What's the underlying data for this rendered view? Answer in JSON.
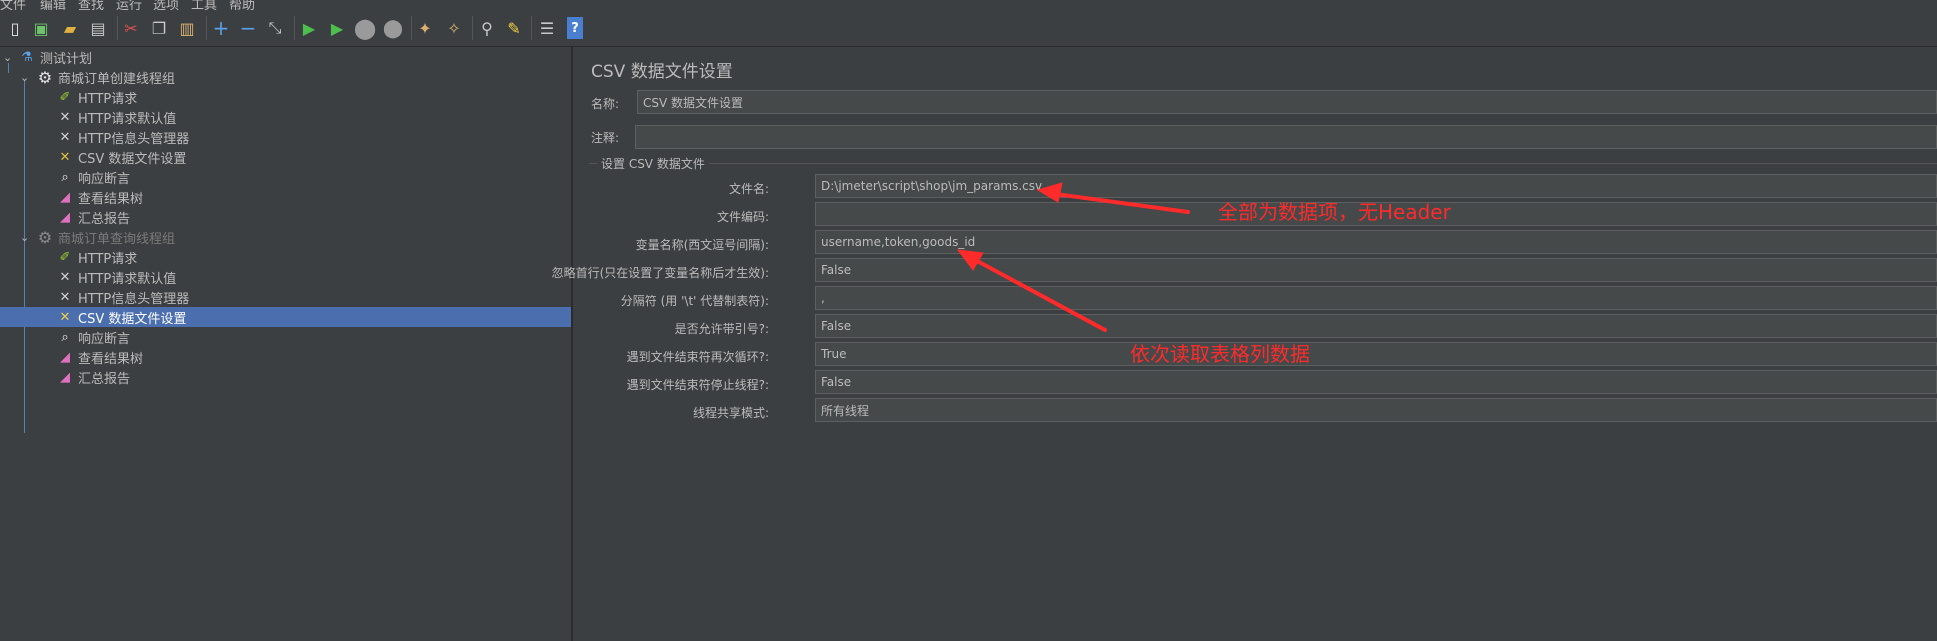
{
  "menu": [
    "文件",
    "编辑",
    "查找",
    "运行",
    "选项",
    "工具",
    "帮助"
  ],
  "toolbar_icons": [
    "new-icon",
    "templates-icon",
    "open-icon",
    "save-icon",
    "cut-icon",
    "copy-icon",
    "paste-icon",
    "expand-icon",
    "collapse-icon",
    "toggle-icon",
    "start-icon",
    "start-no-pause-icon",
    "stop-icon",
    "shutdown-icon",
    "clear-icon",
    "clear-all-icon",
    "search-icon",
    "reset-search-icon",
    "function-helper-icon",
    "help-icon"
  ],
  "tree": {
    "root": "测试计划",
    "group1": "商城订单创建线程组",
    "group1_items": [
      "HTTP请求",
      "HTTP请求默认值",
      "HTTP信息头管理器",
      "CSV 数据文件设置",
      "响应断言",
      "查看结果树",
      "汇总报告"
    ],
    "group2": "商城订单查询线程组",
    "group2_items": [
      "HTTP请求",
      "HTTP请求默认值",
      "HTTP信息头管理器",
      "CSV 数据文件设置",
      "响应断言",
      "查看结果树",
      "汇总报告"
    ]
  },
  "panel": {
    "title": "CSV 数据文件设置",
    "name_label": "名称:",
    "name_value": "CSV 数据文件设置",
    "comment_label": "注释:",
    "comment_value": "",
    "section_title": "设置 CSV 数据文件",
    "fields": [
      {
        "label": "文件名:",
        "value": "D:\\jmeter\\script\\shop\\jm_params.csv"
      },
      {
        "label": "文件编码:",
        "value": ""
      },
      {
        "label": "变量名称(西文逗号间隔):",
        "value": "username,token,goods_id"
      },
      {
        "label": "忽略首行(只在设置了变量名称后才生效):",
        "value": "False"
      },
      {
        "label": "分隔符 (用 '\\t' 代替制表符):",
        "value": ","
      },
      {
        "label": "是否允许带引号?:",
        "value": "False"
      },
      {
        "label": "遇到文件结束符再次循环?:",
        "value": "True"
      },
      {
        "label": "遇到文件结束符停止线程?:",
        "value": "False"
      },
      {
        "label": "线程共享模式:",
        "value": "所有线程"
      }
    ]
  },
  "annotations": {
    "note1": "全部为数据项，无Header",
    "note2": "依次读取表格列数据",
    "color": "#ff2a2a"
  },
  "colors": {
    "background": "#3c3f41",
    "selection": "#4b6eaf",
    "field": "#45494a"
  }
}
